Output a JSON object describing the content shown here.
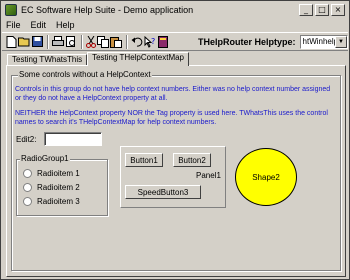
{
  "window": {
    "title": "EC Software Help Suite - Demo application"
  },
  "titlebar_buttons": {
    "minimize": "_",
    "maximize": "□",
    "close": "×"
  },
  "menu": [
    {
      "label": "File"
    },
    {
      "label": "Edit"
    },
    {
      "label": "Help"
    }
  ],
  "toolbar": {
    "icons": [
      "new-file-icon",
      "open-folder-icon",
      "save-icon",
      "print-icon",
      "print-preview-icon",
      "cut-icon",
      "copy-icon",
      "paste-icon",
      "undo-icon",
      "help-icon",
      "help-book-icon"
    ],
    "helptype_label": "THelpRouter Helptype:",
    "helptype_value": "htWinhelp"
  },
  "tabs": [
    {
      "label": "Testing TWhatsThis",
      "active": false
    },
    {
      "label": "Testing THelpContextMap",
      "active": true
    }
  ],
  "group_no_context": {
    "caption": "Some controls without a HelpContext",
    "paragraph1": "Controls in this group do not have help context numbers. Either was no help context number assigned or they do not have a HelpContext property at all.",
    "paragraph2": "NEITHER the HelpContext property NOR the Tag property is used here. TWhatsThis uses the control names to search it's THelpContextMap for help context numbers."
  },
  "edit2": {
    "label": "Edit2:",
    "value": ""
  },
  "radiogroup": {
    "caption": "RadioGroup1",
    "items": [
      {
        "label": "Radioitem 1"
      },
      {
        "label": "Radioitem 2"
      },
      {
        "label": "Radioitem 3"
      }
    ]
  },
  "panel1": {
    "caption": "Panel1",
    "button1": "Button1",
    "button2": "Button2",
    "speedbutton3": "SpeedButton3"
  },
  "shape2": {
    "label": "Shape2"
  },
  "colors": {
    "face": "#d4d0c8",
    "link_text": "#1a1acc",
    "shape_fill": "#ffff00"
  }
}
